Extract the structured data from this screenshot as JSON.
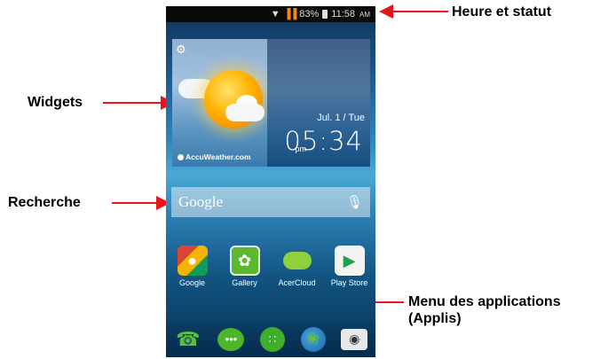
{
  "callouts": {
    "status": "Heure et statut",
    "widgets": "Widgets",
    "search": "Recherche",
    "apps_menu_line1": "Menu des applications",
    "apps_menu_line2": "(Applis)"
  },
  "status_bar": {
    "signal_icon": "signal-icon",
    "wifi_icon": "wifi-icon",
    "battery": "83%",
    "battery_icon": "battery-icon",
    "time": "11:58",
    "ampm": "AM",
    "signal_color": "#ff8a00"
  },
  "weather_widget": {
    "settings_icon": "gear-icon",
    "weather_icon": "sun-cloud-icon",
    "provider": "AccuWeather.com",
    "date": "Jul. 1 / Tue",
    "ampm": "pm",
    "time": "05:34"
  },
  "search": {
    "label": "Google",
    "mic_icon": "microphone-icon"
  },
  "apps": [
    {
      "label": "Google",
      "icon": "google-icon"
    },
    {
      "label": "Gallery",
      "icon": "gallery-icon"
    },
    {
      "label": "AcerCloud",
      "icon": "acercloud-icon"
    },
    {
      "label": "Play Store",
      "icon": "play-store-icon"
    }
  ],
  "dock": [
    {
      "icon": "phone-icon"
    },
    {
      "icon": "messaging-icon"
    },
    {
      "icon": "app-drawer-icon"
    },
    {
      "icon": "browser-globe-icon"
    },
    {
      "icon": "camera-icon"
    }
  ],
  "colors": {
    "arrow": "#e8141c",
    "dock_green": "#3fae2a"
  }
}
